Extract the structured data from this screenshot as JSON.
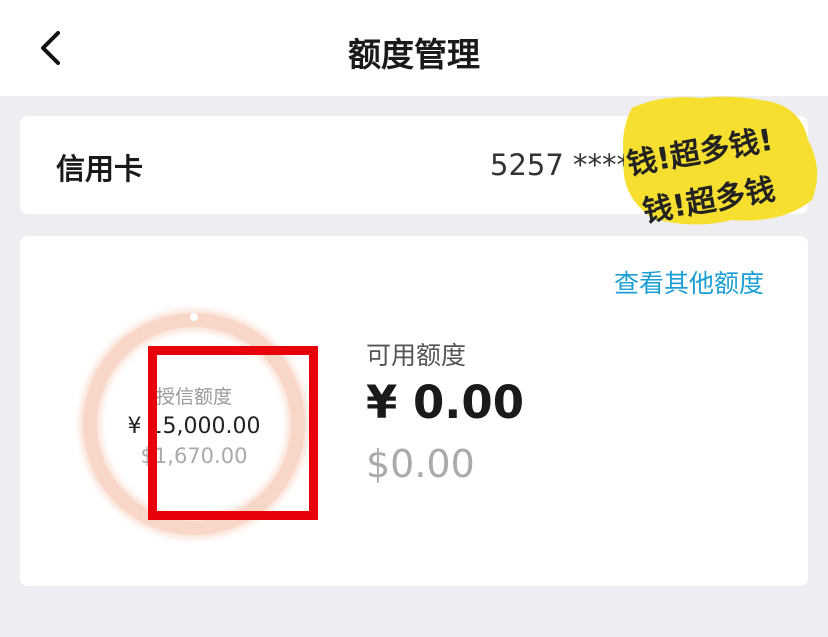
{
  "header": {
    "title": "额度管理"
  },
  "card": {
    "type_label": "信用卡",
    "number_masked": "5257 ****"
  },
  "sticker": {
    "text_line1": "钱!超多钱!",
    "text_line2": "钱!超多钱"
  },
  "limit": {
    "view_other_label": "查看其他额度",
    "credit_label": "授信额度",
    "credit_value": "¥ 15,000.00",
    "credit_usd": "$1,670.00",
    "available_label": "可用额度",
    "available_value": "¥ 0.00",
    "available_usd": "$0.00"
  },
  "colors": {
    "accent_link": "#1a9fd4",
    "ring": "#f9d7c8",
    "highlight_box": "#e8000b",
    "sticker_bg": "#f6df2e"
  }
}
